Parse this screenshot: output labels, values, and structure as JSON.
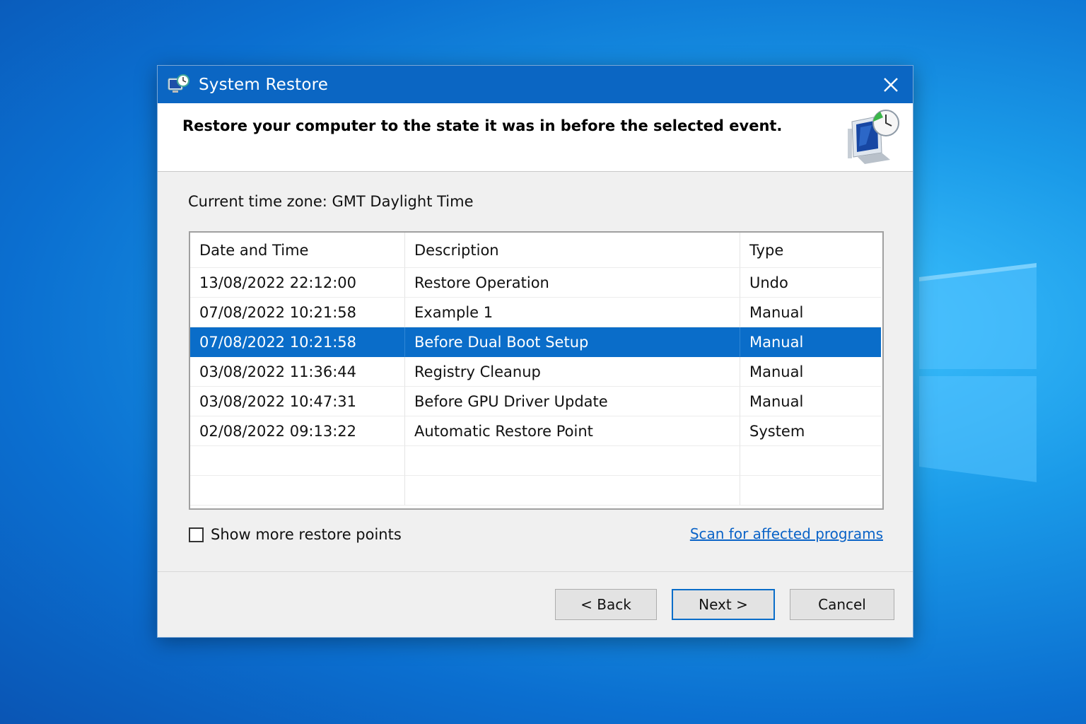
{
  "desktop": {
    "logo_icon": "windows-logo-icon"
  },
  "dialog": {
    "title": "System Restore",
    "app_icon": "system-restore-icon",
    "close_icon": "close-icon"
  },
  "header": {
    "instruction": "Restore your computer to the state it was in before the selected event.",
    "icon": "computer-clock-icon"
  },
  "timezone": "Current time zone: GMT Daylight Time",
  "table": {
    "columns": [
      "Date and Time",
      "Description",
      "Type"
    ],
    "rows": [
      {
        "date": "13/08/2022  22:12:00",
        "description": "Restore Operation",
        "type": "Undo",
        "selected": false
      },
      {
        "date": "07/08/2022  10:21:58",
        "description": "Example 1",
        "type": "Manual",
        "selected": false
      },
      {
        "date": "07/08/2022  10:21:58",
        "description": "Before Dual Boot Setup",
        "type": "Manual",
        "selected": true
      },
      {
        "date": "03/08/2022  11:36:44",
        "description": "Registry Cleanup",
        "type": "Manual",
        "selected": false
      },
      {
        "date": "03/08/2022  10:47:31",
        "description": "Before GPU Driver Update",
        "type": "Manual",
        "selected": false
      },
      {
        "date": "02/08/2022  09:13:22",
        "description": "Automatic Restore Point",
        "type": "System",
        "selected": false
      },
      {
        "date": "",
        "description": "",
        "type": "",
        "selected": false
      },
      {
        "date": "",
        "description": "",
        "type": "",
        "selected": false
      }
    ]
  },
  "options": {
    "show_more_label": "Show more restore points",
    "show_more_checked": false,
    "scan_link": "Scan for affected programs"
  },
  "buttons": {
    "back": "< Back",
    "next": "Next >",
    "cancel": "Cancel"
  },
  "colors": {
    "accent": "#0a6dc9",
    "titlebar": "#0b66c3",
    "link": "#0a63c7"
  }
}
